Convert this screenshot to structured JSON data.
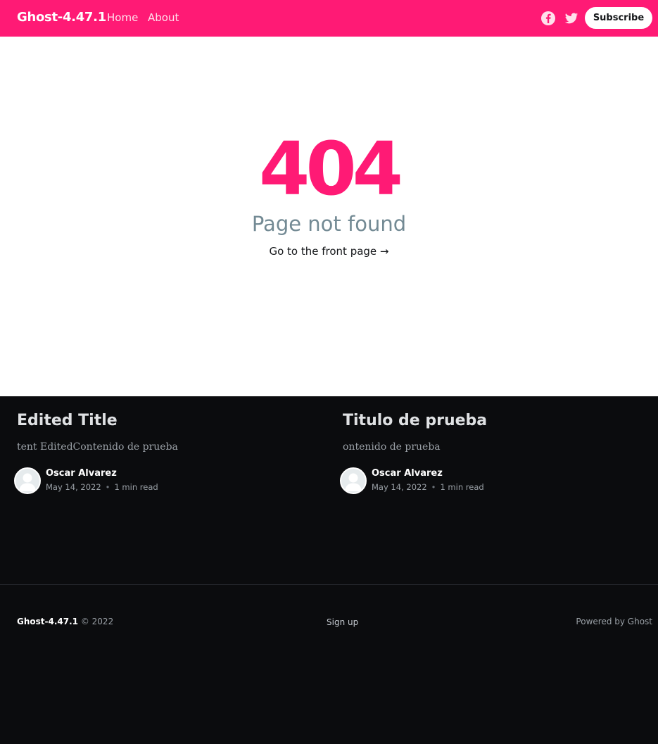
{
  "header": {
    "site_title": "Ghost-4.47.1",
    "nav": [
      "Home",
      "About"
    ],
    "subscribe_label": "Subscribe",
    "accent_color": "#ff1a75",
    "social_icons": [
      "facebook-icon",
      "twitter-icon"
    ]
  },
  "error": {
    "code": "404",
    "message": "Page not found",
    "link_label": "Go to the front page →"
  },
  "feed": [
    {
      "title": "Edited Title",
      "excerpt": "tent EditedContenido de prueba",
      "author": "Oscar Alvarez",
      "date": "May 14, 2022",
      "read_time": "1 min read"
    },
    {
      "title": "Titulo de prueba",
      "excerpt": "ontenido de prueba",
      "author": "Oscar Alvarez",
      "date": "May 14, 2022",
      "read_time": "1 min read"
    }
  ],
  "footer": {
    "site_title": "Ghost-4.47.1",
    "copyright": "© 2022",
    "signup_label": "Sign up",
    "powered_by": "Powered by Ghost"
  }
}
